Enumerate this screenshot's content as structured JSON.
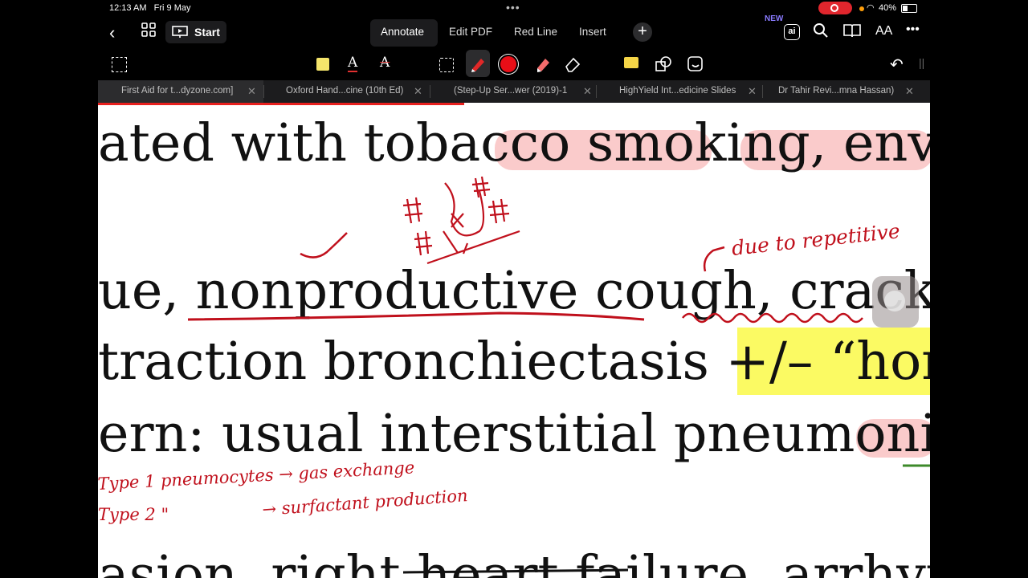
{
  "status_bar": {
    "time": "12:13 AM",
    "date": "Fri 9 May",
    "battery": "40%"
  },
  "toolbar": {
    "start_label": "Start",
    "tabs": [
      "Annotate",
      "Edit PDF",
      "Red Line",
      "Insert"
    ],
    "active_tab": "Annotate",
    "new_badge": "NEW",
    "ai_label": "ai",
    "text_size_label": "AA"
  },
  "document_tabs": [
    {
      "label": "First Aid for t...dyzone.com]"
    },
    {
      "label": "Oxford Hand...cine (10th Ed)"
    },
    {
      "label": "(Step-Up Ser...wer (2019)-1"
    },
    {
      "label": "HighYield Int...edicine Slides"
    },
    {
      "label": "Dr Tahir Revi...mna Hassan)"
    }
  ],
  "page_text": {
    "line1": "ated with tobacco smoking, environm",
    "line2": "ue, nonproductive cough, crackles, cl",
    "line3": "traction bronchiectasis +/– “honeyco",
    "line4": "ern: usual interstitial pneumonia. ↓ ty",
    "line5": "asion, right heart failure, arrhythmias"
  },
  "handwritten_notes": {
    "note1": "due to repetitive",
    "note2": "Type 1 pneumocytes → gas exchange",
    "note3": "Type 2 \"",
    "note4": "→ surfactant production"
  },
  "colors": {
    "highlight_pink": "#f9c2c2",
    "highlight_yellow": "#fbfa63",
    "ink_red": "#c0101c"
  }
}
